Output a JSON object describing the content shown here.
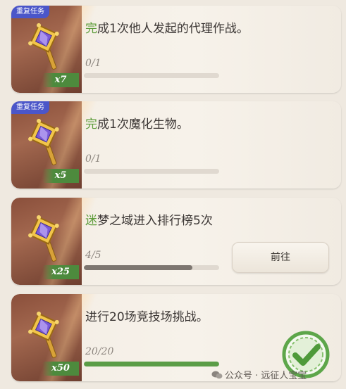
{
  "tasks": [
    {
      "badge": "重复任务",
      "title_highlight": "完",
      "title_rest": "成1次他人发起的代理作战。",
      "reward_count": "x7",
      "progress_text": "0/1",
      "progress": 0.0,
      "state": "in-progress"
    },
    {
      "badge": "重复任务",
      "title_highlight": "完",
      "title_rest": "成1次魔化生物。",
      "reward_count": "x5",
      "progress_text": "0/1",
      "progress": 0.0,
      "state": "in-progress"
    },
    {
      "badge": "",
      "title_highlight": "迷",
      "title_rest": "梦之域进入排行榜5次",
      "reward_count": "x25",
      "progress_text": "4/5",
      "progress": 0.8,
      "action_label": "前往",
      "state": "in-progress"
    },
    {
      "badge": "",
      "title_highlight": "",
      "title_rest": "进行20场竞技场挑战。",
      "reward_count": "x50",
      "progress_text": "20/20",
      "progress": 1.0,
      "state": "completed"
    }
  ],
  "watermark": "公众号 · 远征人宝宝",
  "colors": {
    "badge": "#4b56c9",
    "highlight": "#5f9d3c",
    "progress_gray": "#7d7670",
    "progress_green": "#5b9d47",
    "complete_check": "#5da64a"
  },
  "icons": [
    "crystal-scepter-icon",
    "checkmark-icon",
    "wechat-icon"
  ]
}
